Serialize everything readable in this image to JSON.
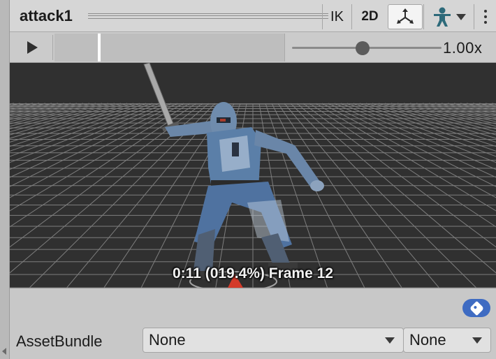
{
  "window": {
    "title": "attack1",
    "buttons": {
      "ik_label": "IK",
      "twod_label": "2D"
    },
    "icons": [
      "move-gizmo-icon",
      "avatar-icon",
      "dropdown-caret-icon",
      "kebab-menu-icon"
    ]
  },
  "playback": {
    "playhead_progress": 0.194,
    "speed_slider_value": 0.47,
    "speed_label": "1.00x"
  },
  "viewport": {
    "frame_info": "0:11 (019.4%) Frame 12",
    "background_color": "#303030",
    "grid_color": "#8c8c8c"
  },
  "asset_bundle": {
    "label": "AssetBundle",
    "bundle_value": "None",
    "variant_value": "None"
  },
  "colors": {
    "tag_button": "#3e6bc2",
    "armor": "#5b7fa8"
  }
}
